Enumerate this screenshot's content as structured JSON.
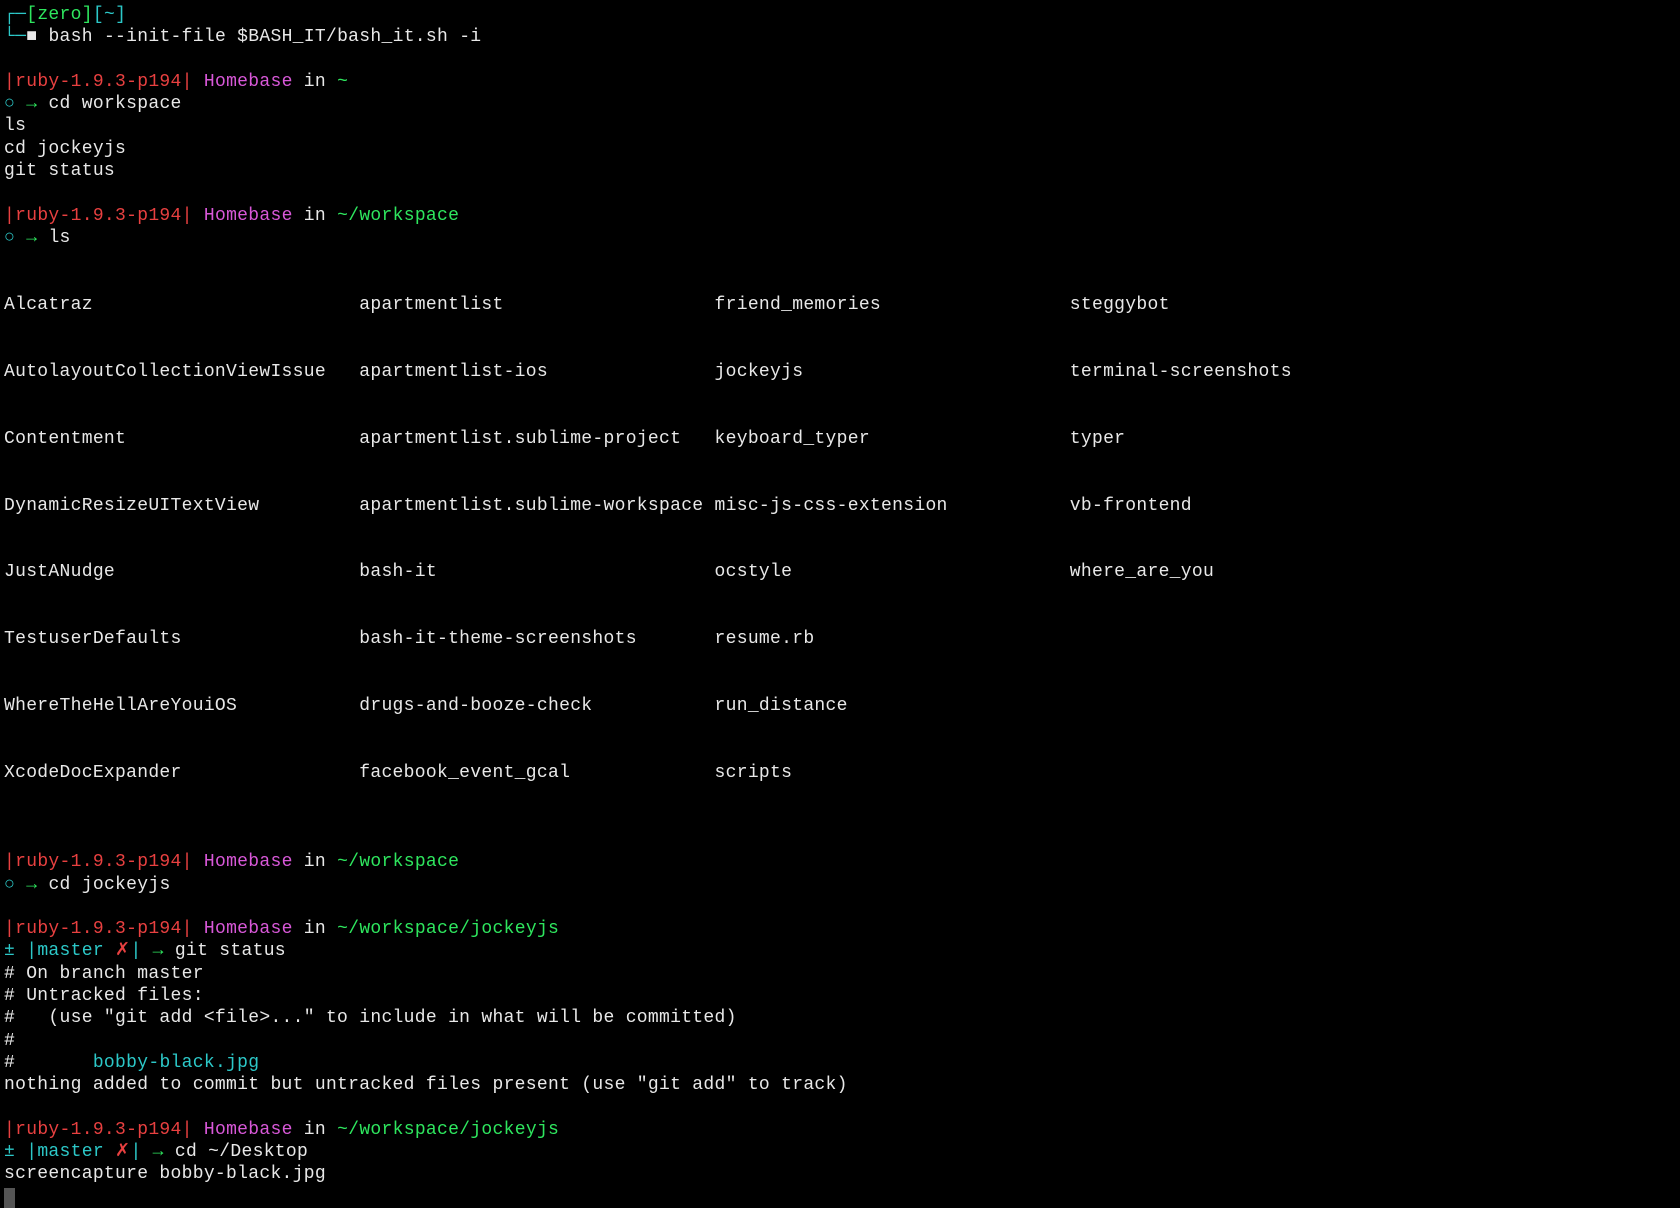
{
  "top": {
    "corner": "┌─",
    "bracket_l": "[",
    "host": "zero",
    "bracket_r": "]",
    "path_bracket_l": "[",
    "path": "~",
    "path_bracket_r": "]",
    "corner2a": "└─",
    "corner2b": "■ ",
    "cmd": "bash --init-file $BASH_IT/bash_it.sh -i"
  },
  "p1": {
    "ruby_l": "|",
    "ruby": "ruby-1.9.3-p194",
    "ruby_r": "| ",
    "host": "Homebase",
    "in": " in ",
    "path": "~",
    "glyph": "○ ",
    "arrow": "→ ",
    "cmd": "cd workspace"
  },
  "history": {
    "l1": "ls",
    "l2": "cd jockeyjs",
    "l3": "git status"
  },
  "p2": {
    "ruby_l": "|",
    "ruby": "ruby-1.9.3-p194",
    "ruby_r": "| ",
    "host": "Homebase",
    "in": " in ",
    "path": "~/workspace",
    "glyph": "○ ",
    "arrow": "→ ",
    "cmd": "ls"
  },
  "ls_table": [
    "Alcatraz                        apartmentlist                   friend_memories                 steggybot",
    "AutolayoutCollectionViewIssue   apartmentlist-ios               jockeyjs                        terminal-screenshots",
    "Contentment                     apartmentlist.sublime-project   keyboard_typer                  typer",
    "DynamicResizeUITextView         apartmentlist.sublime-workspace misc-js-css-extension           vb-frontend",
    "JustANudge                      bash-it                         ocstyle                         where_are_you",
    "TestuserDefaults                bash-it-theme-screenshots       resume.rb",
    "WhereTheHellAreYouiOS           drugs-and-booze-check           run_distance",
    "XcodeDocExpander                facebook_event_gcal             scripts"
  ],
  "p3": {
    "ruby_l": "|",
    "ruby": "ruby-1.9.3-p194",
    "ruby_r": "| ",
    "host": "Homebase",
    "in": " in ",
    "path": "~/workspace",
    "glyph": "○ ",
    "arrow": "→ ",
    "cmd": "cd jockeyjs"
  },
  "p4": {
    "ruby_l": "|",
    "ruby": "ruby-1.9.3-p194",
    "ruby_r": "| ",
    "host": "Homebase",
    "in": " in ",
    "path": "~/workspace/jockeyjs",
    "git_glyph": "± ",
    "git_l": "|",
    "git_branch": "master ",
    "git_x": "✗",
    "git_r": "| ",
    "arrow": "→ ",
    "cmd": "git status"
  },
  "gitstatus": {
    "l1": "# On branch master",
    "l2": "# Untracked files:",
    "l3": "#   (use \"git add <file>...\" to include in what will be committed)",
    "l4": "#",
    "l5a": "#       ",
    "l5b": "bobby-black.jpg",
    "l6": "nothing added to commit but untracked files present (use \"git add\" to track)"
  },
  "p5": {
    "ruby_l": "|",
    "ruby": "ruby-1.9.3-p194",
    "ruby_r": "| ",
    "host": "Homebase",
    "in": " in ",
    "path": "~/workspace/jockeyjs",
    "git_glyph": "± ",
    "git_l": "|",
    "git_branch": "master ",
    "git_x": "✗",
    "git_r": "| ",
    "arrow": "→ ",
    "cmd": "cd ~/Desktop"
  },
  "tail": {
    "l1": "screencapture bobby-black.jpg"
  }
}
